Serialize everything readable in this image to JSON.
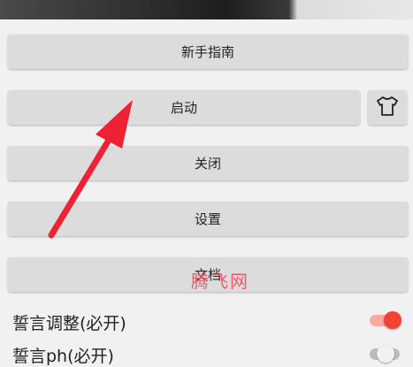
{
  "buttons": {
    "guide": "新手指南",
    "start": "启动",
    "close": "关闭",
    "settings": "设置",
    "docs": "文档"
  },
  "settings": {
    "oath_adjust": {
      "label": "誓言调整(必开)",
      "on": true
    },
    "oath_ph": {
      "label": "誓言ph(必开)",
      "on": false
    }
  },
  "watermark": "腾飞网",
  "colors": {
    "accent": "#f44336",
    "annotation_arrow": "#ee2232",
    "button_bg": "#dcdcdc"
  },
  "icons": {
    "skin": "tshirt-icon"
  }
}
